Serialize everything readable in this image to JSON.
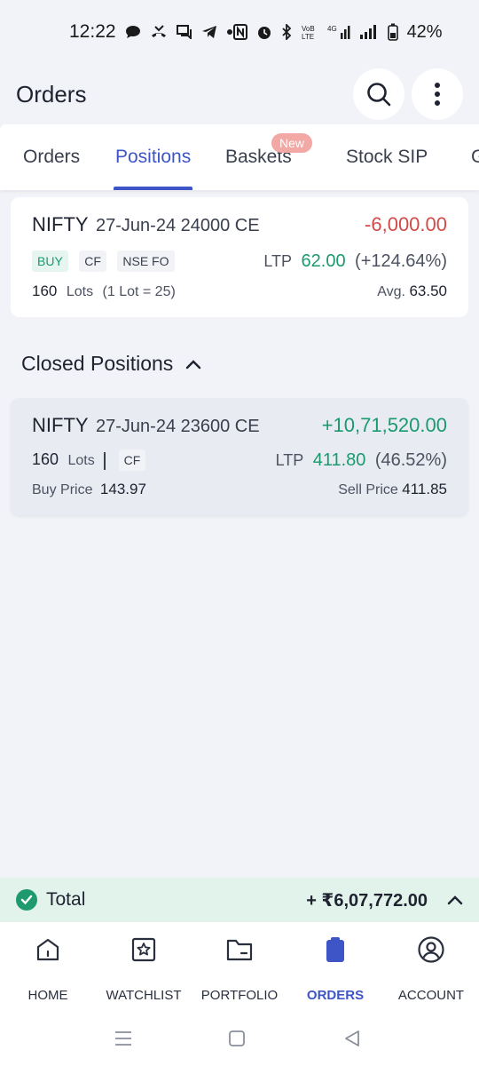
{
  "status_bar": {
    "time": "12:22",
    "network": "4G",
    "battery": "42%"
  },
  "header": {
    "title": "Orders",
    "search_icon": "search-icon",
    "menu_icon": "more-vertical-icon"
  },
  "tabs": [
    {
      "label": "Orders",
      "active": false
    },
    {
      "label": "Positions",
      "active": true
    },
    {
      "label": "Baskets",
      "active": false,
      "badge": "New"
    },
    {
      "label": "Stock SIP",
      "active": false
    },
    {
      "label": "G",
      "active": false
    }
  ],
  "open_position": {
    "symbol": "NIFTY",
    "contract": "27-Jun-24 24000 CE",
    "pnl": "-6,000.00",
    "tags": [
      "BUY",
      "CF",
      "NSE FO"
    ],
    "ltp_label": "LTP",
    "ltp_value": "62.00",
    "ltp_change": "(+124.64%)",
    "lots_count": "160",
    "lots_label": "Lots",
    "lot_size": "(1 Lot = 25)",
    "avg_label": "Avg.",
    "avg_value": "63.50"
  },
  "closed_section": {
    "title": "Closed Positions",
    "expanded": true
  },
  "closed_position": {
    "symbol": "NIFTY",
    "contract": "27-Jun-24 23600 CE",
    "pnl": "+10,71,520.00",
    "lots_count": "160",
    "lots_label": "Lots",
    "tag": "CF",
    "ltp_label": "LTP",
    "ltp_value": "411.80",
    "ltp_change": "(46.52%)",
    "buy_label": "Buy Price",
    "buy_value": "143.97",
    "sell_label": "Sell Price",
    "sell_value": "411.85"
  },
  "total": {
    "label": "Total",
    "value": "+ ₹6,07,772.00"
  },
  "bottom_nav": [
    {
      "label": "HOME",
      "icon": "home-icon",
      "active": false
    },
    {
      "label": "WATCHLIST",
      "icon": "star-bookmark-icon",
      "active": false
    },
    {
      "label": "PORTFOLIO",
      "icon": "folder-icon",
      "active": false
    },
    {
      "label": "ORDERS",
      "icon": "clipboard-icon",
      "active": true
    },
    {
      "label": "ACCOUNT",
      "icon": "user-circle-icon",
      "active": false
    }
  ],
  "colors": {
    "accent": "#3d55c6",
    "positive": "#1a9a6e",
    "negative": "#d24a48",
    "background": "#f1f3f8"
  }
}
